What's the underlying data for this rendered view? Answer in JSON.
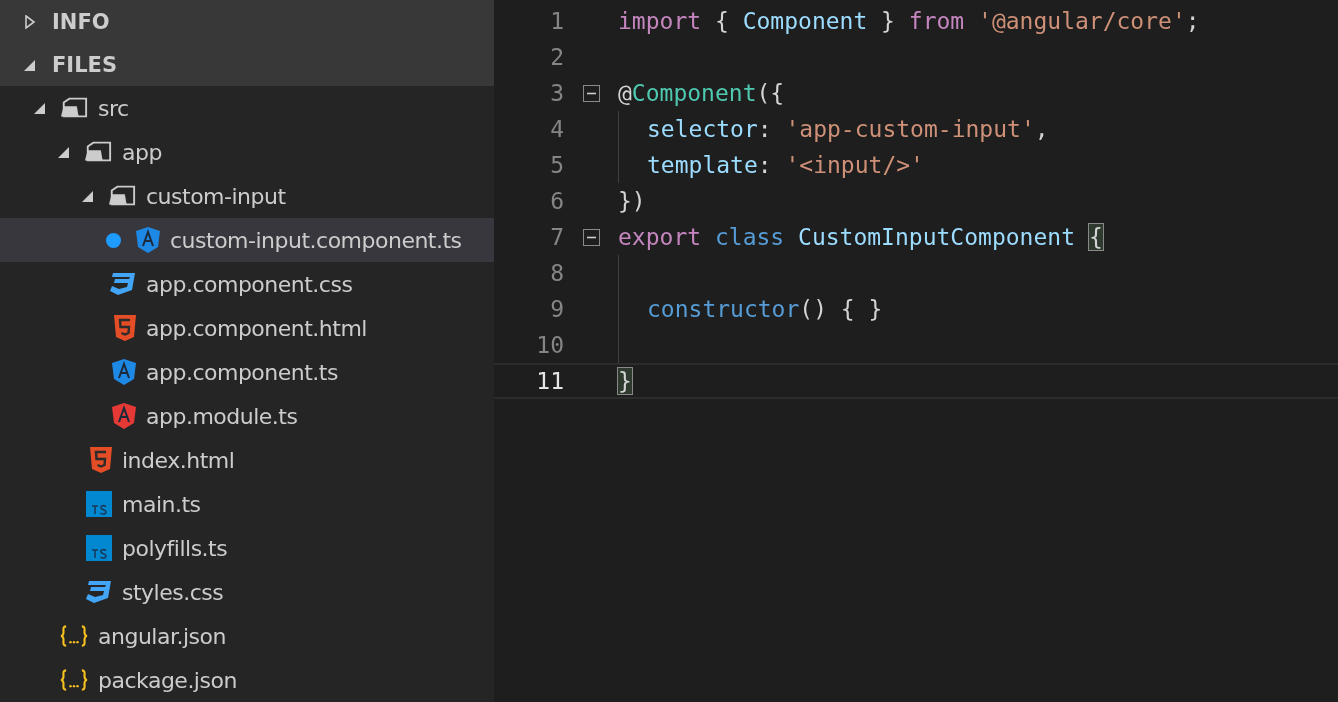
{
  "sidebar": {
    "sections": [
      {
        "label": "INFO",
        "expanded": false
      },
      {
        "label": "FILES",
        "expanded": true
      }
    ],
    "tree": [
      {
        "kind": "folder",
        "name": "src",
        "expanded": true,
        "children": [
          {
            "kind": "folder",
            "name": "app",
            "expanded": true,
            "children": [
              {
                "kind": "folder",
                "name": "custom-input",
                "expanded": true,
                "children": [
                  {
                    "kind": "angular",
                    "color": "#1e88e5",
                    "name": "custom-input.component.ts",
                    "selected": true,
                    "modified": true
                  }
                ]
              },
              {
                "kind": "css",
                "name": "app.component.css",
                "selected": false,
                "modified": false
              },
              {
                "kind": "html",
                "name": "app.component.html",
                "selected": false,
                "modified": false
              },
              {
                "kind": "angular",
                "color": "#1e88e5",
                "name": "app.component.ts",
                "selected": false,
                "modified": false
              },
              {
                "kind": "angular",
                "color": "#e53935",
                "name": "app.module.ts",
                "selected": false,
                "modified": false
              }
            ]
          },
          {
            "kind": "html",
            "name": "index.html",
            "selected": false,
            "modified": false
          },
          {
            "kind": "typescript",
            "name": "main.ts",
            "selected": false,
            "modified": false
          },
          {
            "kind": "typescript",
            "name": "polyfills.ts",
            "selected": false,
            "modified": false
          },
          {
            "kind": "css",
            "name": "styles.css",
            "selected": false,
            "modified": false
          }
        ]
      },
      {
        "kind": "json",
        "name": "angular.json",
        "selected": false,
        "modified": false
      },
      {
        "kind": "json",
        "name": "package.json",
        "selected": false,
        "modified": false
      }
    ]
  },
  "editor": {
    "lines": [
      {
        "number": "1",
        "fold": false,
        "indent": false,
        "current": false,
        "tokens": [
          {
            "kind": "keyword",
            "text": "import"
          },
          {
            "kind": "plain",
            "text": " { "
          },
          {
            "kind": "type",
            "text": "Component"
          },
          {
            "kind": "plain",
            "text": " } "
          },
          {
            "kind": "keyword",
            "text": "from"
          },
          {
            "kind": "string",
            "text": " '@angular/core'"
          },
          {
            "kind": "plain",
            "text": ";"
          }
        ]
      },
      {
        "number": "2",
        "fold": false,
        "indent": false,
        "current": false
      },
      {
        "number": "3",
        "fold": true,
        "indent": false,
        "current": false,
        "tokens": [
          {
            "kind": "plain",
            "text": "@"
          },
          {
            "kind": "decorator",
            "text": "Component"
          },
          {
            "kind": "plain",
            "text": "({"
          }
        ]
      },
      {
        "number": "4",
        "fold": false,
        "indent": true,
        "current": false,
        "tokens": [
          {
            "kind": "property",
            "text": "selector"
          },
          {
            "kind": "plain",
            "text": ": "
          },
          {
            "kind": "string",
            "text": "'app-custom-input'"
          },
          {
            "kind": "plain",
            "text": ","
          }
        ]
      },
      {
        "number": "5",
        "fold": false,
        "indent": true,
        "current": false,
        "tokens": [
          {
            "kind": "property",
            "text": "template"
          },
          {
            "kind": "plain",
            "text": ": "
          },
          {
            "kind": "string",
            "text": "'<input/>'"
          }
        ]
      },
      {
        "number": "6",
        "fold": false,
        "indent": false,
        "current": false,
        "tokens": [
          {
            "kind": "plain",
            "text": "})"
          }
        ]
      },
      {
        "number": "7",
        "fold": true,
        "indent": false,
        "current": false,
        "tokens": [
          {
            "kind": "keyword",
            "text": "export"
          },
          {
            "kind": "storage",
            "text": " class"
          },
          {
            "kind": "type",
            "text": " CustomInputComponent"
          },
          {
            "kind": "bracket",
            "text": "{"
          }
        ]
      },
      {
        "number": "8",
        "fold": false,
        "indent": true,
        "current": false
      },
      {
        "number": "9",
        "fold": false,
        "indent": true,
        "current": false,
        "tokens": [
          {
            "kind": "storage",
            "text": "constructor"
          },
          {
            "kind": "plain",
            "text": "() { }"
          }
        ]
      },
      {
        "number": "10",
        "fold": false,
        "indent": true,
        "current": false
      },
      {
        "number": "11",
        "fold": false,
        "indent": false,
        "current": true,
        "tokens": [
          {
            "kind": "bracket",
            "text": "}"
          }
        ]
      }
    ]
  }
}
